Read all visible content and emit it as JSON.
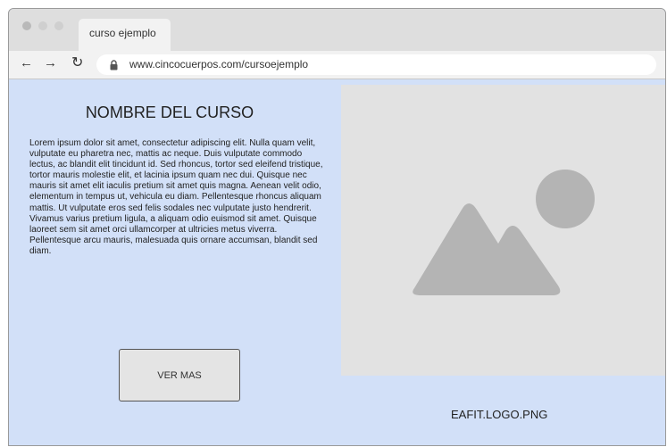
{
  "browser": {
    "tab_title": "curso ejemplo",
    "url": "www.cincocuerpos.com/cursoejemplo",
    "nav_icons": [
      "back-arrow-icon",
      "forward-arrow-icon",
      "reload-icon",
      "lock-icon"
    ]
  },
  "page": {
    "course_title": "NOMBRE DEL CURSO",
    "course_description": "Lorem ipsum dolor sit amet, consectetur adipiscing elit. Nulla quam velit, vulputate eu pharetra nec, mattis ac neque. Duis vulputate commodo lectus, ac blandit elit tincidunt id. Sed rhoncus, tortor sed eleifend tristique, tortor mauris molestie elit, et lacinia ipsum quam nec dui. Quisque nec mauris sit amet elit iaculis pretium sit amet quis magna. Aenean velit odio, elementum in tempus ut, vehicula eu diam. Pellentesque rhoncus aliquam mattis. Ut vulputate eros sed felis sodales nec vulputate justo hendrerit. Vivamus varius pretium ligula, a aliquam odio euismod sit amet. Quisque laoreet sem sit amet orci ullamcorper at ultricies metus viverra. Pellentesque arcu mauris, malesuada quis ornare accumsan, blandit sed diam.",
    "button_label": "VER MAS",
    "image_icon": "image-placeholder-icon",
    "logo_caption": "EAFIT.LOGO.PNG"
  },
  "colors": {
    "page_background": "#d2e0f8",
    "placeholder_background": "#e2e2e2",
    "placeholder_shapes": "#b4b4b4",
    "chrome_bar": "#dedede",
    "address_bar": "#f2f2f2"
  }
}
